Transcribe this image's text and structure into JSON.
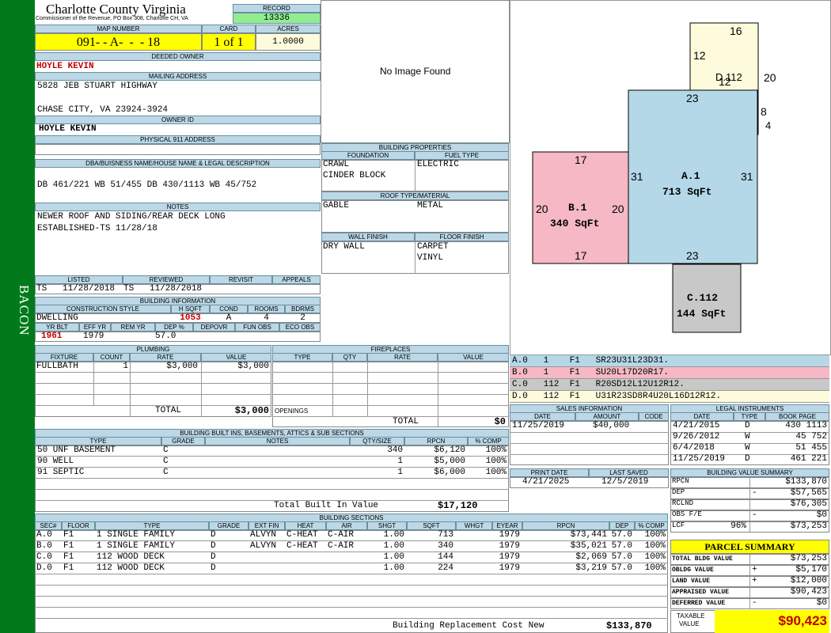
{
  "side_label": "BACON",
  "county": {
    "name": "Charlotte County Virginia",
    "subtitle": "Commissioner of the Revenue, PO Box 308, Charlotte CH, VA"
  },
  "record": {
    "label": "RECORD",
    "value": "13336"
  },
  "map_number": {
    "label": "MAP NUMBER",
    "value": "091- - A-  -  - 18"
  },
  "card": {
    "label": "CARD",
    "value": "1 of 1"
  },
  "acres": {
    "label": "ACRES",
    "value": "1.0000"
  },
  "deeded_owner": {
    "label": "DEEDED OWNER",
    "value": "HOYLE KEVIN"
  },
  "mailing_address": {
    "label": "MAILING ADDRESS",
    "line1": "5828 JEB STUART HIGHWAY",
    "line2": "CHASE CITY, VA 23924-3924"
  },
  "owner_id": {
    "label": "OWNER ID",
    "value": "HOYLE KEVIN"
  },
  "physical_address": {
    "label": "PHYSICAL 911 ADDRESS",
    "value": ""
  },
  "legal": {
    "label": "DBA/BUISNESS NAME/HOUSE NAME & LEGAL DESCRIPTION",
    "value": "DB 461/221 WB 51/455 DB 430/1113 WB 45/752"
  },
  "notes": {
    "label": "NOTES",
    "line1": "NEWER ROOF AND SIDING/REAR DECK LONG",
    "line2": "ESTABLISHED-TS 11/28/18"
  },
  "photo": {
    "text": "No Image Found"
  },
  "dates": {
    "listed_label": "LISTED",
    "listed": "TS   11/28/2018",
    "reviewed_label": "REVIEWED",
    "reviewed": "TS   11/28/2018",
    "revisit_label": "REVISIT",
    "appeals_label": "APPEALS"
  },
  "building_info": {
    "label": "BUILDING INFORMATION",
    "style_label": "CONSTRUCTION STYLE",
    "style": "DWELLING",
    "hsqft_label": "H SQFT",
    "hsqft": "1053",
    "cond_label": "COND",
    "cond": "A",
    "rooms_label": "ROOMS",
    "rooms": "4",
    "bdrms_label": "BDRMS",
    "bdrms": "2",
    "yrblt_label": "YR BLT",
    "yrblt": "1961",
    "effyr_label": "EFF YR",
    "effyr": "1979",
    "remyr_label": "REM YR",
    "dep_label": "DEP %",
    "dep": "57.0",
    "depovr_label": "DEPOVR",
    "funobs_label": "FUN OBS",
    "ecoobs_label": "ECO OBS"
  },
  "building_props": {
    "label": "BUILDING PROPERTIES",
    "foundation_label": "FOUNDATION",
    "foundation1": "CRAWL",
    "foundation2": "CINDER BLOCK",
    "fuel_label": "FUEL TYPE",
    "fuel": "ELECTRIC",
    "roof_label": "ROOF TYPE/MATERIAL",
    "roof_type": "GABLE",
    "roof_material": "METAL",
    "wall_label": "WALL FINISH",
    "wall": "DRY WALL",
    "floor_label": "FLOOR FINISH",
    "floor1": "CARPET",
    "floor2": "VINYL"
  },
  "plumbing": {
    "label": "PLUMBING",
    "headers": [
      "FIXTURE",
      "COUNT",
      "RATE",
      "VALUE"
    ],
    "row": [
      "FULLBATH",
      "1",
      "$3,000",
      "$3,000"
    ],
    "total_label": "TOTAL",
    "total": "$3,000"
  },
  "fireplaces": {
    "label": "FIREPLACES",
    "headers": [
      "TYPE",
      "QTY",
      "RATE",
      "VALUE"
    ],
    "openings_label": "OPENINGS",
    "total_label": "TOTAL",
    "total": "$0"
  },
  "builtins": {
    "label": "BUILDING BUILT INS, BASEMENTS, ATTICS & SUB SECTIONS",
    "headers": [
      "TYPE",
      "GRADE",
      "NOTES",
      "QTY/SIZE",
      "RPCN",
      "% COMP"
    ],
    "rows": [
      [
        "50 UNF BASEMENT",
        "C",
        "",
        "340",
        "$6,120",
        "100%"
      ],
      [
        "90 WELL",
        "C",
        "",
        "1",
        "$5,000",
        "100%"
      ],
      [
        "91 SEPTIC",
        "C",
        "",
        "1",
        "$6,000",
        "100%"
      ]
    ],
    "total_label": "Total Built In Value",
    "total": "$17,120"
  },
  "sections": {
    "label": "BUILDING SECTIONS",
    "headers": [
      "SEC#",
      "FLOOR",
      "TYPE",
      "GRADE",
      "EXT FIN",
      "HEAT",
      "AIR",
      "SHGT",
      "SQFT",
      "WHGT",
      "EYEAR",
      "RPCN",
      "DEP",
      "% COMP"
    ],
    "rows": [
      [
        "A.0",
        "F1",
        "1 SINGLE FAMILY",
        "D",
        "ALVYN",
        "C-HEAT",
        "C-AIR",
        "1.00",
        "713",
        "",
        "1979",
        "$73,441",
        "57.0",
        "100%"
      ],
      [
        "B.0",
        "F1",
        "1 SINGLE FAMILY",
        "D",
        "ALVYN",
        "C-HEAT",
        "C-AIR",
        "1.00",
        "340",
        "",
        "1979",
        "$35,021",
        "57.0",
        "100%"
      ],
      [
        "C.0",
        "F1",
        "112 WOOD DECK",
        "D",
        "",
        "",
        "",
        "1.00",
        "144",
        "",
        "1979",
        "$2,069",
        "57.0",
        "100%"
      ],
      [
        "D.0",
        "F1",
        "112 WOOD DECK",
        "D",
        "",
        "",
        "",
        "1.00",
        "224",
        "",
        "1979",
        "$3,219",
        "57.0",
        "100%"
      ]
    ],
    "replacement_label": "Building Replacement Cost New",
    "replacement": "$133,870"
  },
  "sketch": {
    "a_label": "A.1",
    "a_area": "713 SqFt",
    "b_label": "B.1",
    "b_area": "340 SqFt",
    "c_label": "C.112",
    "c_area": "144 SqFt",
    "d_label": "D.112",
    "dims": {
      "a_top": "23",
      "a_bottom": "23",
      "a_left": "31",
      "a_right": "31",
      "b_top": "17",
      "b_bottom": "17",
      "b_left": "20",
      "b_right": "20",
      "d_top": "16",
      "d_left": "12",
      "d_inner": "12",
      "d_right": "20",
      "d_8": "8",
      "d_4": "4"
    },
    "colors": {
      "a": "#b4d8e8",
      "b": "#f5b8c4",
      "c": "#c8c8c8",
      "d": "#fdfbdc"
    }
  },
  "vectors": [
    {
      "text": "A.0   1    F1   SR23U31L23D31.",
      "color": "#b4d8e8"
    },
    {
      "text": "B.0   1    F1   SU20L17D20R17.",
      "color": "#f5b8c4"
    },
    {
      "text": "C.0   112  F1   R20SD12L12U12R12.",
      "color": "#c8c8c8"
    },
    {
      "text": "D.0   112  F1   U31R23SD8R4U20L16D12R12.",
      "color": "#fdfbdc"
    }
  ],
  "sales": {
    "label": "SALES INFORMATION",
    "headers": [
      "DATE",
      "AMOUNT",
      "CODE"
    ],
    "row": [
      "11/25/2019",
      "$40,000",
      ""
    ]
  },
  "legal_instruments": {
    "label": "LEGAL INSTRUMENTS",
    "headers": [
      "DATE",
      "TYPE",
      "BOOK PAGE"
    ],
    "rows": [
      [
        "4/21/2015",
        "D",
        "430 1113"
      ],
      [
        "9/26/2012",
        "W",
        "45 752"
      ],
      [
        "6/4/2018",
        "W",
        "51 455"
      ],
      [
        "11/25/2019",
        "D",
        "461 221"
      ]
    ]
  },
  "print": {
    "print_label": "PRINT DATE",
    "print_date": "4/21/2025",
    "saved_label": "LAST SAVED",
    "saved_date": "12/5/2019"
  },
  "value_summary": {
    "label": "BUILDING VALUE SUMMARY",
    "rows": [
      {
        "k": "RPCN",
        "s": "",
        "v": "$133,870"
      },
      {
        "k": "DEP",
        "s": "-",
        "v": "$57,565"
      },
      {
        "k": "RCLND",
        "s": "",
        "v": "$76,305"
      },
      {
        "k": "OBS F/E",
        "s": "-",
        "v": "$0"
      },
      {
        "k": "LCF",
        "p": "96%",
        "s": "",
        "v": "$73,253"
      }
    ]
  },
  "parcel": {
    "label": "PARCEL SUMMARY",
    "rows": [
      {
        "k": "TOTAL BLDG VALUE",
        "s": "",
        "v": "$73,253"
      },
      {
        "k": "OBLDG VALUE",
        "s": "+",
        "v": "$5,170"
      },
      {
        "k": "LAND VALUE",
        "s": "+",
        "v": "$12,000"
      },
      {
        "k": "APPRAISED VALUE",
        "s": "",
        "v": "$90,423"
      },
      {
        "k": "DEFERRED VALUE",
        "s": "-",
        "v": "$0"
      }
    ],
    "taxable_label1": "TAXABLE",
    "taxable_label2": "VALUE",
    "taxable": "$90,423"
  }
}
